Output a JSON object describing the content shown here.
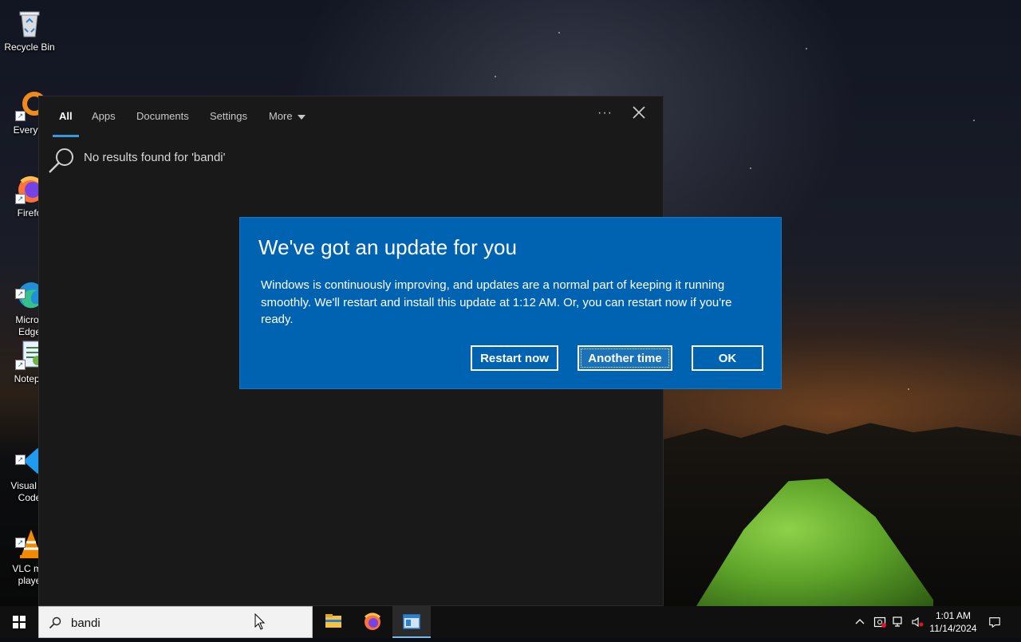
{
  "desktop": {
    "icons": [
      {
        "label": "Recycle Bin",
        "icon": "recycle-bin-icon"
      },
      {
        "label": "Everyth",
        "icon": "everything-icon"
      },
      {
        "label": "Firefo",
        "icon": "firefox-icon"
      },
      {
        "label": "Micros\nEdge",
        "icon": "edge-icon"
      },
      {
        "label": "Notepa",
        "icon": "notepad-icon"
      },
      {
        "label": "Visual St\nCode",
        "icon": "vscode-icon"
      },
      {
        "label": "VLC me\nplaye",
        "icon": "vlc-icon"
      }
    ]
  },
  "search_panel": {
    "tabs": [
      {
        "label": "All",
        "active": true
      },
      {
        "label": "Apps",
        "active": false
      },
      {
        "label": "Documents",
        "active": false
      },
      {
        "label": "Settings",
        "active": false
      },
      {
        "label": "More",
        "active": false
      }
    ],
    "options_label": "···",
    "no_results_text": "No results found for 'bandi'"
  },
  "dialog": {
    "title": "We've got an update for you",
    "body": "Windows is continuously improving, and updates are a normal part of keeping it running smoothly. We'll restart and install this update at 1:12 AM. Or, you can restart now if you're ready.",
    "buttons": {
      "restart_now": "Restart now",
      "another_time": "Another time",
      "ok": "OK"
    },
    "focused_button": "another_time",
    "accent_color": "#0063b1"
  },
  "taskbar": {
    "search_value": "bandi",
    "pinned": [
      "file-explorer-icon",
      "firefox-icon",
      "active-window-icon"
    ],
    "clock": {
      "time": "1:01 AM",
      "date": "11/14/2024"
    }
  }
}
